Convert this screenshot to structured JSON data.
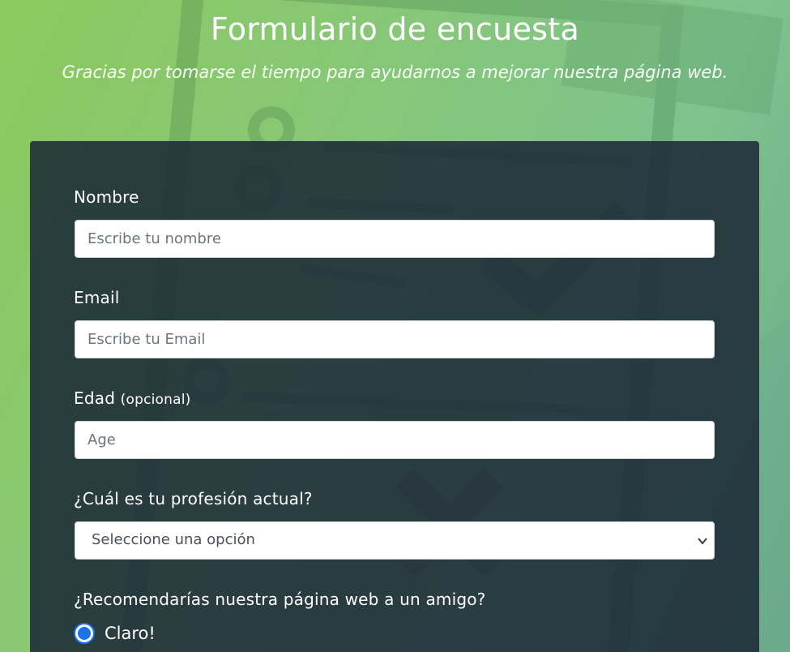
{
  "header": {
    "title": "Formulario de encuesta",
    "subtitle": "Gracias por tomarse el tiempo para ayudarnos a mejorar nuestra página web."
  },
  "form": {
    "name": {
      "label": "Nombre",
      "placeholder": "Escribe tu nombre",
      "value": ""
    },
    "email": {
      "label": "Email",
      "placeholder": "Escribe tu Email",
      "value": ""
    },
    "age": {
      "label": "Edad",
      "optional_note": "(opcional)",
      "placeholder": "Age",
      "value": ""
    },
    "profession": {
      "label": "¿Cuál es tu profesión actual?",
      "selected": "Seleccione una opción"
    },
    "recommend": {
      "question": "¿Recomendarías nuestra página web a un amigo?",
      "options": [
        {
          "label": "Claro!",
          "checked": true
        }
      ]
    }
  },
  "colors": {
    "background_start": "#8cc95e",
    "background_end": "#6aa98a",
    "card": "#1b2735",
    "radio_accent": "#1a73e8",
    "text": "#ffffff"
  },
  "icons": {
    "select_arrow": "chevron-down-icon"
  }
}
